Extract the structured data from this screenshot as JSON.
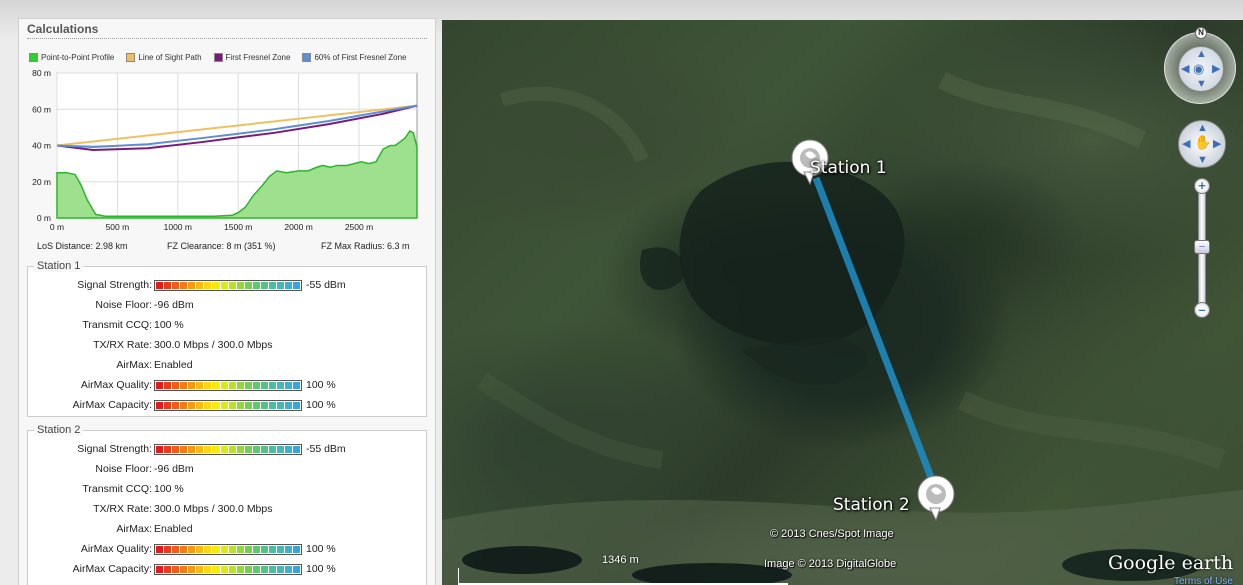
{
  "panel": {
    "title": "Calculations",
    "legend": [
      {
        "label": "Point-to-Point Profile",
        "color": "#33cc33"
      },
      {
        "label": "Line of Sight Path",
        "color": "#f0c060"
      },
      {
        "label": "First Fresnel Zone",
        "color": "#7a1a7a"
      },
      {
        "label": "60% of First Fresnel Zone",
        "color": "#5c8fd6"
      }
    ],
    "stats": {
      "los_distance": "LoS Distance: 2.98 km",
      "fz_clearance": "FZ Clearance: 8 m  (351 %)",
      "fz_max_radius": "FZ Max Radius: 6.3 m"
    }
  },
  "chart_data": {
    "type": "area",
    "xlabel": "",
    "ylabel": "",
    "xlim": [
      0,
      2980
    ],
    "ylim": [
      0,
      80
    ],
    "x_ticks": [
      "0 m",
      "500 m",
      "1000 m",
      "1500 m",
      "2000 m",
      "2500 m"
    ],
    "x_tick_values": [
      0,
      500,
      1000,
      1500,
      2000,
      2500
    ],
    "y_ticks": [
      "0 m",
      "20 m",
      "40 m",
      "60 m",
      "80 m"
    ],
    "y_tick_values": [
      0,
      20,
      40,
      60,
      80
    ],
    "grid": true,
    "series": [
      {
        "name": "Point-to-Point Profile",
        "x": [
          0,
          80,
          150,
          200,
          250,
          320,
          400,
          500,
          700,
          900,
          1100,
          1300,
          1450,
          1500,
          1560,
          1620,
          1700,
          1760,
          1820,
          1900,
          2000,
          2080,
          2150,
          2200,
          2260,
          2320,
          2400,
          2460,
          2520,
          2580,
          2640,
          2700,
          2760,
          2800,
          2840,
          2880,
          2920,
          2950,
          2980
        ],
        "y": [
          25,
          25,
          24,
          18,
          10,
          2,
          1,
          1,
          1,
          1,
          1,
          1,
          1.5,
          3,
          6,
          12,
          18,
          23,
          26,
          25,
          26,
          26,
          28,
          29,
          28,
          29,
          29,
          30,
          31,
          30,
          31,
          38,
          40,
          40,
          42,
          44,
          48,
          47,
          39
        ]
      },
      {
        "name": "Line of Sight Path",
        "x": [
          0,
          2980
        ],
        "y": [
          40,
          62
        ]
      },
      {
        "name": "First Fresnel Zone",
        "x": [
          0,
          300,
          750,
          1200,
          1490,
          1800,
          2250,
          2700,
          2980
        ],
        "y": [
          40,
          37.5,
          38.5,
          41.9,
          44.4,
          47,
          51.8,
          57.5,
          62
        ]
      },
      {
        "name": "60% of First Fresnel Zone",
        "x": [
          0,
          300,
          750,
          1200,
          1490,
          1800,
          2250,
          2700,
          2980
        ],
        "y": [
          40,
          39.2,
          40.7,
          44.1,
          46.4,
          49.0,
          53.5,
          58.8,
          62
        ]
      }
    ]
  },
  "stations": [
    {
      "label": "Station 1",
      "signal_strength_label": "Signal Strength:",
      "signal_strength_value": "-55 dBm",
      "signal_strength_level": 1.0,
      "noise_floor_label": "Noise Floor:",
      "noise_floor_value": "-96 dBm",
      "ccq_label": "Transmit CCQ:",
      "ccq_value": "100 %",
      "rate_label": "TX/RX Rate:",
      "rate_value": "300.0 Mbps / 300.0 Mbps",
      "airmax_label": "AirMax:",
      "airmax_value": "Enabled",
      "airmax_quality_label": "AirMax Quality:",
      "airmax_quality_value": "100 %",
      "airmax_quality_level": 1.0,
      "airmax_capacity_label": "AirMax Capacity:",
      "airmax_capacity_value": "100 %",
      "airmax_capacity_level": 1.0
    },
    {
      "label": "Station 2",
      "signal_strength_label": "Signal Strength:",
      "signal_strength_value": "-55 dBm",
      "signal_strength_level": 1.0,
      "noise_floor_label": "Noise Floor:",
      "noise_floor_value": "-96 dBm",
      "ccq_label": "Transmit CCQ:",
      "ccq_value": "100 %",
      "rate_label": "TX/RX Rate:",
      "rate_value": "300.0 Mbps / 300.0 Mbps",
      "airmax_label": "AirMax:",
      "airmax_value": "Enabled",
      "airmax_quality_label": "AirMax Quality:",
      "airmax_quality_value": "100 %",
      "airmax_quality_level": 1.0,
      "airmax_capacity_label": "AirMax Capacity:",
      "airmax_capacity_value": "100 %",
      "airmax_capacity_level": 1.0
    }
  ],
  "map": {
    "station1_label": "Station 1",
    "station2_label": "Station 2",
    "copyright_cnes": "© 2013 Cnes/Spot Image",
    "copyright_image": "Image © 2013 DigitalGlobe",
    "scale_label": "1346 m",
    "brand": "Google earth",
    "terms": "Terms of Use",
    "compass_letter": "N",
    "link_color": "#1e8fc7",
    "icons": [
      "compass-icon",
      "look-icon",
      "pan-hand-icon",
      "zoom-in-icon",
      "zoom-out-icon",
      "station-pin-icon"
    ]
  },
  "meter_colors": [
    "#e31b1b",
    "#ee3a1a",
    "#f25a18",
    "#f57a16",
    "#f89914",
    "#fbb812",
    "#fdd710",
    "#f6ea0e",
    "#d9ea1a",
    "#b6e22a",
    "#92d83c",
    "#73cf52",
    "#5ec96a",
    "#52c386",
    "#4dbda2",
    "#46b6bc",
    "#3eaed2",
    "#35a5e2"
  ]
}
